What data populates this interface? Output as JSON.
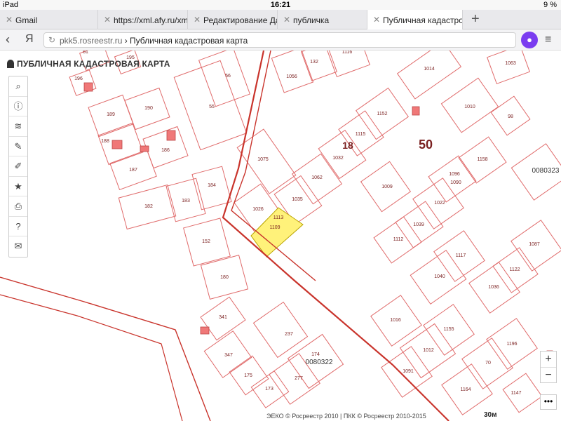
{
  "status": {
    "device": "iPad",
    "time": "16:21",
    "battery": "9 %"
  },
  "tabs": [
    {
      "label": "Gmail"
    },
    {
      "label": "https://xml.afy.ru/xml/le"
    },
    {
      "label": "Редактирование Дачн"
    },
    {
      "label": "публичка"
    },
    {
      "label": "Публичная кадастровая"
    }
  ],
  "address": {
    "domain": "pkk5.rosreestr.ru",
    "separator": " › ",
    "title": "Публичная кадастровая карта",
    "engine_glyph": "Я"
  },
  "map": {
    "logo": "ПУБЛИЧНАЯ КАДАСТРОВАЯ КАРТА",
    "parcel_labels": [
      "61",
      "195",
      "196",
      "189",
      "190",
      "188",
      "186",
      "187",
      "56",
      "55",
      "1056",
      "132",
      "1116",
      "1014",
      "1063",
      "1075",
      "1032",
      "1115",
      "1152",
      "1010",
      "98",
      "18",
      "50",
      "1062",
      "1026",
      "1035",
      "1158",
      "1096",
      "0080323",
      "1090",
      "1009",
      "1022",
      "1039",
      "1112",
      "1117",
      "1087",
      "1122",
      "1040",
      "1036",
      "1016",
      "1155",
      "1012",
      "1196",
      "70",
      "1091",
      "1164",
      "1147",
      "174",
      "0080322",
      "237",
      "277",
      "341",
      "347",
      "175",
      "173",
      "182",
      "183",
      "184",
      "152",
      "180",
      "1113",
      "1109"
    ],
    "highlight_parcel": "1113",
    "scale": "30м",
    "copyright": "ЭЕКО © Росреестр 2010 | ПКК © Росреестр 2010-2015"
  },
  "tools": [
    {
      "icon": "search-icon",
      "glyph": "⌕"
    },
    {
      "icon": "info-icon",
      "glyph": "ⓘ"
    },
    {
      "icon": "layers-icon",
      "glyph": "≋"
    },
    {
      "icon": "pencil-icon",
      "glyph": "✎"
    },
    {
      "icon": "edit-area-icon",
      "glyph": "✐"
    },
    {
      "icon": "star-icon",
      "glyph": "★"
    },
    {
      "icon": "print-icon",
      "glyph": "⎙"
    },
    {
      "icon": "help-icon",
      "glyph": "?"
    },
    {
      "icon": "mail-icon",
      "glyph": "✉"
    }
  ],
  "zoom": {
    "plus": "+",
    "minus": "−",
    "more": "•••"
  },
  "colors": {
    "parcel_stroke": "#e06b6b",
    "highlight_fill": "#fff27a",
    "building_fill": "#f07878",
    "bold_boundary": "#c9342c",
    "label": "#7a1f1f"
  }
}
